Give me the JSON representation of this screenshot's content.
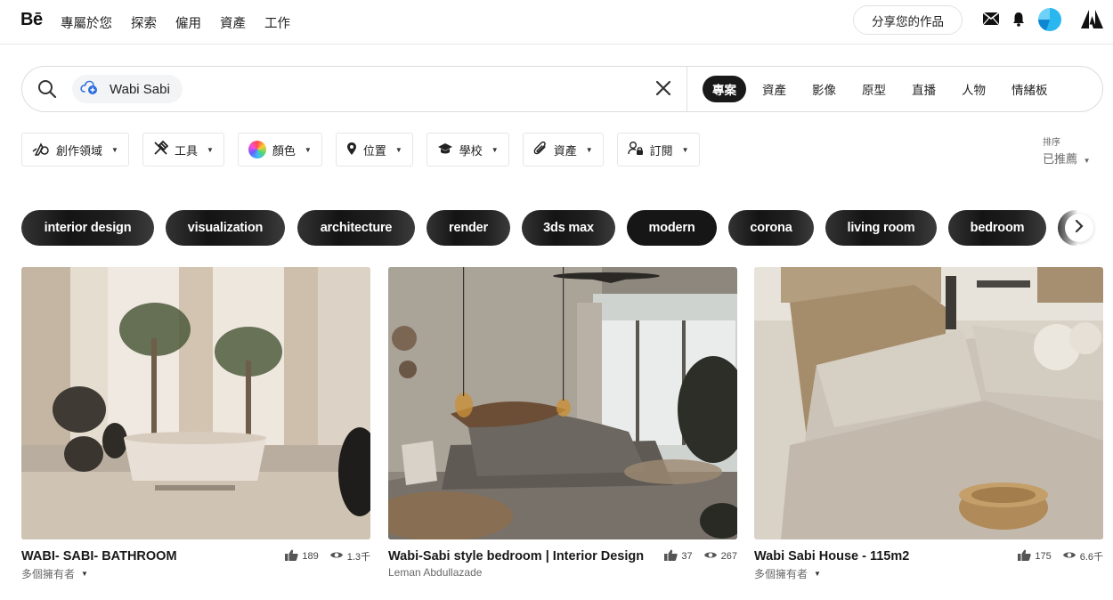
{
  "header": {
    "logo": "Bē",
    "nav": [
      "專屬於您",
      "探索",
      "僱用",
      "資產",
      "工作"
    ],
    "share_button": "分享您的作品",
    "icons": [
      "mail-icon",
      "bell-icon",
      "avatar",
      "adobe-logo-icon"
    ]
  },
  "search": {
    "query_chip": "Wabi Sabi",
    "tabs": [
      "專案",
      "資產",
      "影像",
      "原型",
      "直播",
      "人物",
      "情緒板"
    ],
    "active_tab": "專案"
  },
  "filters": {
    "items": [
      "創作領域",
      "工具",
      "顏色",
      "位置",
      "學校",
      "資產",
      "訂閱"
    ],
    "sort_label": "排序",
    "sort_value": "已推薦"
  },
  "tags": [
    "interior design",
    "visualization",
    "architecture",
    "render",
    "3ds max",
    "modern",
    "corona",
    "living room",
    "bedroom"
  ],
  "projects": [
    {
      "title": "WABI- SABI- BATHROOM",
      "owner": "多個擁有者",
      "likes": "189",
      "views": "1.3千"
    },
    {
      "title": "Wabi-Sabi style bedroom | Interior Design",
      "owner": "Leman Abdullazade",
      "likes": "37",
      "views": "267"
    },
    {
      "title": "Wabi Sabi House - 115m2",
      "owner": "多個擁有者",
      "likes": "175",
      "views": "6.6千"
    }
  ],
  "colors": {
    "accent_dark": "#191919",
    "avatar": "#1fa8e8"
  }
}
